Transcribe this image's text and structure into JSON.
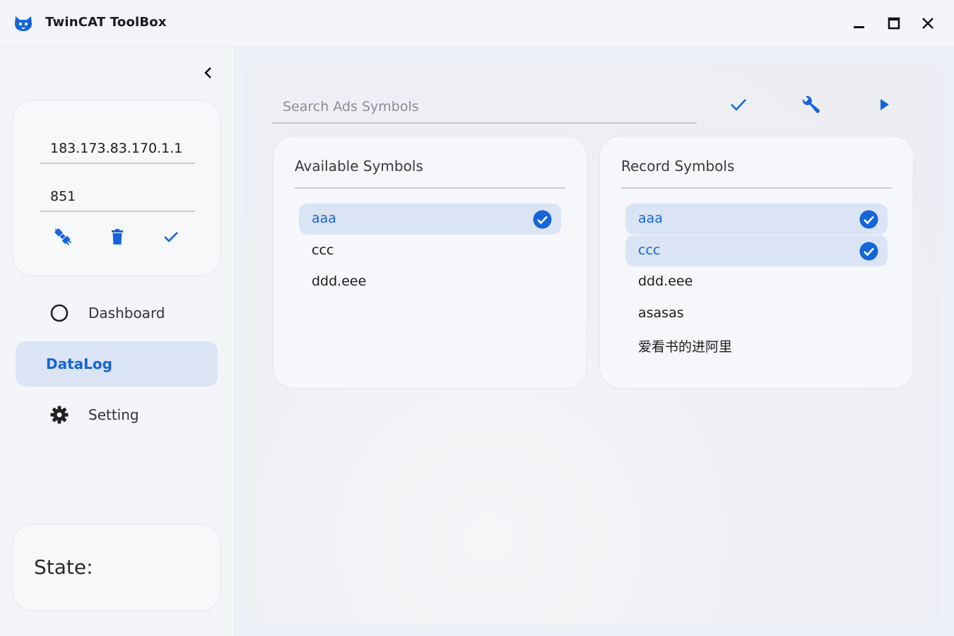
{
  "app": {
    "title": "TwinCAT ToolBox",
    "accent_color": "#1565d8",
    "icons": {
      "logo": "app-logo-icon",
      "minimize": "minimize-icon",
      "maximize": "maximize-icon",
      "close": "close-icon"
    }
  },
  "sidebar": {
    "collapse_icon": "chevron-left-icon",
    "connection": {
      "ip_value": "183.173.83.170.1.1",
      "port_value": "851",
      "actions": [
        "plug-icon",
        "trash-icon",
        "check-icon"
      ]
    },
    "nav": [
      {
        "label": "Dashboard",
        "icon": "circle-outline-icon",
        "active": false
      },
      {
        "label": "DataLog",
        "icon": "",
        "active": true
      },
      {
        "label": "Setting",
        "icon": "gear-icon",
        "active": false
      }
    ],
    "state": {
      "label": "State:"
    }
  },
  "main": {
    "search": {
      "placeholder": "Search Ads Symbols",
      "value": ""
    },
    "toolbar": [
      "check-icon",
      "wrench-icon",
      "play-icon"
    ],
    "available": {
      "title": "Available Symbols",
      "items": [
        {
          "label": "aaa",
          "selected": true
        },
        {
          "label": "ccc",
          "selected": false
        },
        {
          "label": "ddd.eee",
          "selected": false
        }
      ]
    },
    "record": {
      "title": "Record Symbols",
      "items": [
        {
          "label": "aaa",
          "selected": true
        },
        {
          "label": "ccc",
          "selected": true
        },
        {
          "label": "ddd.eee",
          "selected": false
        },
        {
          "label": "asasas",
          "selected": false
        },
        {
          "label": "爱看书的进阿里",
          "selected": false
        }
      ]
    }
  }
}
